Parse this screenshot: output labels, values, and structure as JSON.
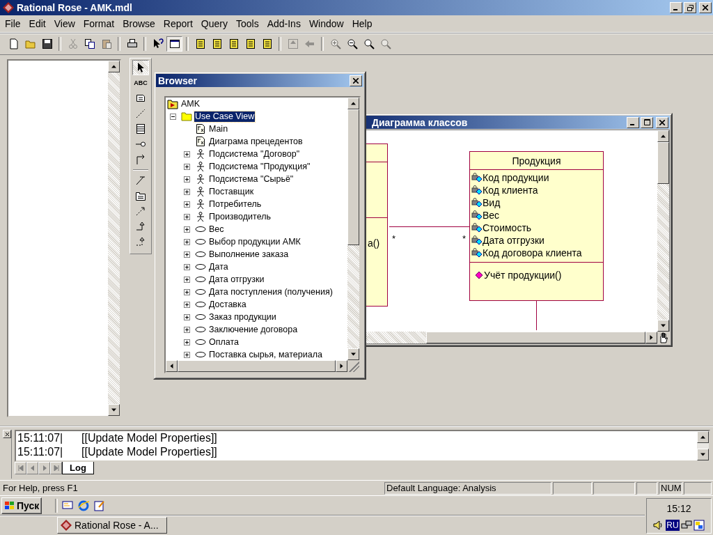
{
  "window": {
    "title": "Rational Rose - AMK.mdl"
  },
  "menu": [
    "File",
    "Edit",
    "View",
    "Format",
    "Browse",
    "Report",
    "Query",
    "Tools",
    "Add-Ins",
    "Window",
    "Help"
  ],
  "toolbar": [
    [
      {
        "kind": "new",
        "disabled": false,
        "selected": false
      },
      {
        "kind": "open",
        "disabled": false,
        "selected": false
      },
      {
        "kind": "save",
        "disabled": false,
        "selected": false
      }
    ],
    [
      {
        "kind": "cut",
        "disabled": true,
        "selected": false
      },
      {
        "kind": "copy",
        "disabled": false,
        "selected": false
      },
      {
        "kind": "paste",
        "disabled": true,
        "selected": false
      }
    ],
    [
      {
        "kind": "print",
        "disabled": false,
        "selected": false
      }
    ],
    [
      {
        "kind": "help",
        "disabled": false,
        "selected": false
      },
      {
        "kind": "browse",
        "disabled": false,
        "selected": true
      }
    ],
    [
      {
        "kind": "diagram",
        "disabled": false,
        "selected": false
      },
      {
        "kind": "diagram",
        "disabled": false,
        "selected": false
      },
      {
        "kind": "diagram",
        "disabled": false,
        "selected": false
      },
      {
        "kind": "diagram",
        "disabled": false,
        "selected": false
      },
      {
        "kind": "diagram",
        "disabled": false,
        "selected": false
      }
    ],
    [
      {
        "kind": "up",
        "disabled": true,
        "selected": false
      },
      {
        "kind": "back",
        "disabled": true,
        "selected": false
      }
    ],
    [
      {
        "kind": "zoom-in",
        "disabled": true,
        "selected": false
      },
      {
        "kind": "zoom-out",
        "disabled": false,
        "selected": false
      },
      {
        "kind": "fit",
        "disabled": false,
        "selected": false
      },
      {
        "kind": "fit",
        "disabled": true,
        "selected": false
      }
    ]
  ],
  "toolbox": [
    [
      {
        "kind": "select",
        "selected": true
      },
      {
        "kind": "text",
        "label": "ABC",
        "selected": false
      },
      {
        "kind": "note",
        "selected": false
      },
      {
        "kind": "anchor",
        "selected": false
      },
      {
        "kind": "class",
        "selected": false
      },
      {
        "kind": "interface",
        "selected": false
      },
      {
        "kind": "association",
        "selected": false
      }
    ],
    [
      {
        "kind": "generalization",
        "selected": false
      },
      {
        "kind": "package",
        "selected": false
      },
      {
        "kind": "dependency",
        "selected": false
      },
      {
        "kind": "realize",
        "selected": false
      },
      {
        "kind": "realize-dashed",
        "selected": false
      }
    ]
  ],
  "browser": {
    "title": "Browser",
    "tree": [
      {
        "label": "AMK",
        "kind": "model",
        "selected": false,
        "children": [
          {
            "label": "Use Case View",
            "kind": "folder",
            "selected": true,
            "expanded": true,
            "children": [
              {
                "label": "Main",
                "kind": "diagram",
                "selected": false
              },
              {
                "label": "Диаграма прецедентов",
                "kind": "diagram",
                "selected": false
              },
              {
                "label": "Подсистема \"Договор\"",
                "kind": "actor",
                "selected": false,
                "expanded": false
              },
              {
                "label": "Подсистема \"Продукция\"",
                "kind": "actor",
                "selected": false,
                "expanded": false
              },
              {
                "label": "Подсистема \"Сырьё\"",
                "kind": "actor",
                "selected": false,
                "expanded": false
              },
              {
                "label": "Поставщик",
                "kind": "actor",
                "selected": false,
                "expanded": false
              },
              {
                "label": "Потребитель",
                "kind": "actor",
                "selected": false,
                "expanded": false
              },
              {
                "label": "Производитель",
                "kind": "actor",
                "selected": false,
                "expanded": false
              },
              {
                "label": "Вес",
                "kind": "usecase",
                "selected": false,
                "expanded": false
              },
              {
                "label": "Выбор продукции АМК",
                "kind": "usecase",
                "selected": false,
                "expanded": false
              },
              {
                "label": "Выполнение заказа",
                "kind": "usecase",
                "selected": false,
                "expanded": false
              },
              {
                "label": "Дата",
                "kind": "usecase",
                "selected": false,
                "expanded": false
              },
              {
                "label": "Дата отгрузки",
                "kind": "usecase",
                "selected": false,
                "expanded": false
              },
              {
                "label": "Дата поступления (получения)",
                "kind": "usecase",
                "selected": false,
                "expanded": false
              },
              {
                "label": "Доставка",
                "kind": "usecase",
                "selected": false,
                "expanded": false
              },
              {
                "label": "Заказ продукции",
                "kind": "usecase",
                "selected": false,
                "expanded": false
              },
              {
                "label": "Заключение договора",
                "kind": "usecase",
                "selected": false,
                "expanded": false
              },
              {
                "label": "Оплата",
                "kind": "usecase",
                "selected": false,
                "expanded": false
              },
              {
                "label": "Поставка сырья, материала",
                "kind": "usecase",
                "selected": false,
                "expanded": false
              }
            ]
          }
        ]
      }
    ]
  },
  "diagram": {
    "title": "Диаграмма классов",
    "partial_class": {
      "operation": "а()"
    },
    "association": {
      "multiplicities": [
        "*",
        "*"
      ]
    },
    "class": {
      "name": "Продукция",
      "attributes": [
        "Код продукции",
        "Код клиента",
        "Вид",
        "Вес",
        "Стоимость",
        "Дата отгрузки",
        "Код договора клиента"
      ],
      "operations": [
        "Учёт продукции()"
      ]
    }
  },
  "log": {
    "lines": [
      {
        "time": "15:11:07|",
        "message": "[[Update Model Properties]]"
      },
      {
        "time": "15:11:07|",
        "message": "[[Update Model Properties]]"
      }
    ],
    "tabs": [
      {
        "label": "Log",
        "selected": true
      }
    ]
  },
  "status_bar": {
    "help": "For Help, press F1",
    "language": "Default Language: Analysis",
    "indicator": "NUM"
  },
  "taskbar": {
    "start": "Пуск",
    "tasks": [
      {
        "label": "Rational Rose - A...",
        "selected": false
      }
    ],
    "language": "RU",
    "clock": "15:12"
  }
}
